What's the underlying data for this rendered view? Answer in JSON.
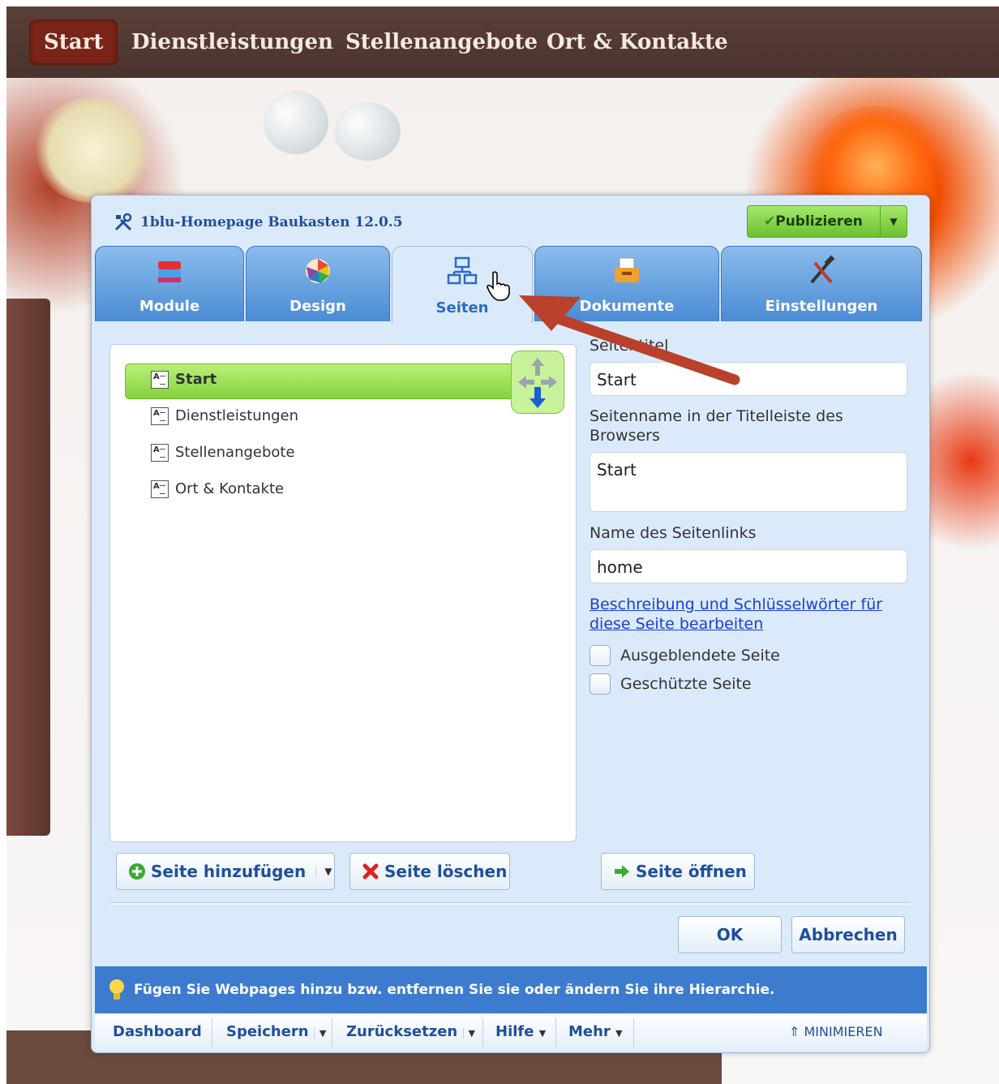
{
  "site_nav": {
    "items": [
      "Start",
      "Dienstleistungen",
      "Stellenangebote",
      "Ort & Kontakte"
    ]
  },
  "dialog": {
    "title": "1blu-Homepage Baukasten 12.0.5",
    "publish_label": "Publizieren",
    "tabs": [
      "Module",
      "Design",
      "Seiten",
      "Dokumente",
      "Einstellungen"
    ],
    "active_tab": "Seiten",
    "pages": [
      "Start",
      "Dienstleistungen",
      "Stellenangebote",
      "Ort & Kontakte"
    ],
    "selected_page": "Start",
    "form": {
      "title_label": "Seitentitel",
      "title_value": "Start",
      "browser_title_label": "Seitenname in der Titelleiste des Browsers",
      "browser_title_value": "Start",
      "link_name_label": "Name des Seitenlinks",
      "link_name_value": "home",
      "description_link": "Beschreibung und Schlüsselwörter für diese Seite bearbeiten",
      "hidden_label": "Ausgeblendete Seite",
      "protected_label": "Geschützte Seite"
    },
    "buttons": {
      "add_page": "Seite hinzufügen",
      "delete_page": "Seite löschen",
      "open_page": "Seite öffnen",
      "ok": "OK",
      "cancel": "Abbrechen"
    },
    "hint": "Fügen Sie Webpages hinzu bzw. entfernen Sie sie oder ändern Sie ihre Hierarchie.",
    "footer": {
      "dashboard": "Dashboard",
      "save": "Speichern",
      "reset": "Zurücksetzen",
      "help": "Hilfe",
      "more": "Mehr",
      "minimize": "MINIMIEREN"
    }
  },
  "colors": {
    "accent_green": "#84d23c",
    "tab_blue": "#4a8bd4",
    "hint_bar": "#3d7bcf",
    "annotation_arrow": "#b9412b"
  }
}
